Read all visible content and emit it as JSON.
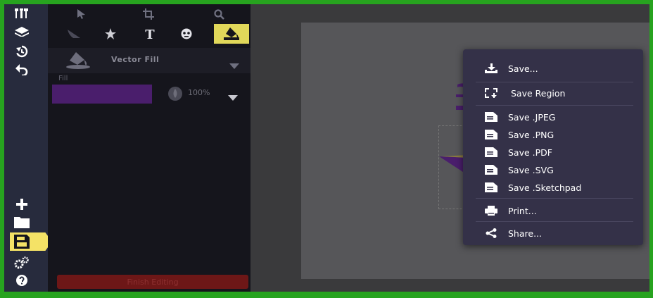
{
  "sidebar": {
    "save_active_color": "#f4e266",
    "top_icons": [
      "tools-icon",
      "layers-icon",
      "history-icon",
      "undo-icon"
    ],
    "bottom_icons": [
      "add-icon",
      "folder-icon",
      "save-icon",
      "settings-icon",
      "help-icon"
    ]
  },
  "tool_panel": {
    "fill_type": "Vector Fill",
    "fill_label": "Fill",
    "fill_color": "#4a1e6c",
    "opacity": "100%",
    "finish_label": "Finish Editing",
    "active_tool_color": "#e1d85a"
  },
  "save_menu": {
    "items": [
      {
        "label": "Save...",
        "icon": "download-icon"
      },
      {
        "label": "Save Region",
        "icon": "region-icon"
      },
      {
        "label": "Save .JPEG",
        "icon": "file-icon"
      },
      {
        "label": "Save .PNG",
        "icon": "file-icon"
      },
      {
        "label": "Save .PDF",
        "icon": "file-icon"
      },
      {
        "label": "Save .SVG",
        "icon": "file-icon"
      },
      {
        "label": "Save .Sketchpad",
        "icon": "file-icon"
      },
      {
        "label": "Print...",
        "icon": "printer-icon"
      },
      {
        "label": "Share...",
        "icon": "share-icon"
      }
    ]
  }
}
